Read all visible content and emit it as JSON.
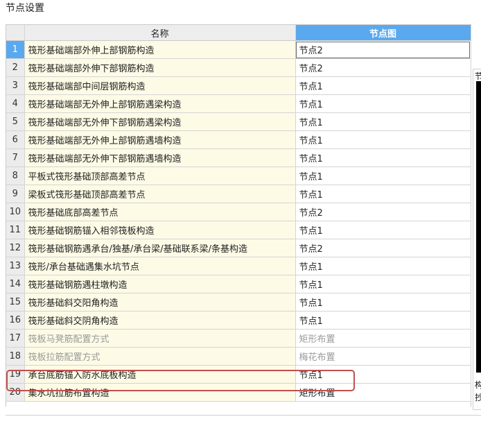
{
  "window": {
    "title": "节点设置"
  },
  "table": {
    "headers": {
      "name": "名称",
      "node": "节点图"
    },
    "rows": [
      {
        "num": "1",
        "name": "筏形基础端部外伸上部钢筋构造",
        "value": "节点2"
      },
      {
        "num": "2",
        "name": "筏形基础端部外伸下部钢筋构造",
        "value": "节点2"
      },
      {
        "num": "3",
        "name": "筏形基础端部中间层钢筋构造",
        "value": "节点1"
      },
      {
        "num": "4",
        "name": "筏形基础端部无外伸上部钢筋遇梁构造",
        "value": "节点1"
      },
      {
        "num": "5",
        "name": "筏形基础端部无外伸下部钢筋遇梁构造",
        "value": "节点1"
      },
      {
        "num": "6",
        "name": "筏形基础端部无外伸上部钢筋遇墙构造",
        "value": "节点1"
      },
      {
        "num": "7",
        "name": "筏形基础端部无外伸下部钢筋遇墙构造",
        "value": "节点1"
      },
      {
        "num": "8",
        "name": "平板式筏形基础顶部高差节点",
        "value": "节点1"
      },
      {
        "num": "9",
        "name": "梁板式筏形基础顶部高差节点",
        "value": "节点1"
      },
      {
        "num": "10",
        "name": "筏形基础底部高差节点",
        "value": "节点2"
      },
      {
        "num": "11",
        "name": "筏形基础钢筋锚入相邻筏板构造",
        "value": "节点1"
      },
      {
        "num": "12",
        "name": "筏形基础钢筋遇承台/独基/承台梁/基础联系梁/条基构造",
        "value": "节点2"
      },
      {
        "num": "13",
        "name": "筏形/承台基础遇集水坑节点",
        "value": "节点1"
      },
      {
        "num": "14",
        "name": "筏形基础钢筋遇柱墩构造",
        "value": "节点1"
      },
      {
        "num": "15",
        "name": "筏形基础斜交阳角构造",
        "value": "节点1"
      },
      {
        "num": "16",
        "name": "筏形基础斜交阴角构造",
        "value": "节点1"
      },
      {
        "num": "17",
        "name": "筏板马凳筋配置方式",
        "value": "矩形布置"
      },
      {
        "num": "18",
        "name": "筏板拉筋配置方式",
        "value": "梅花布置"
      },
      {
        "num": "19",
        "name": "承台底筋锚入防水底板构造",
        "value": "节点1"
      },
      {
        "num": "20",
        "name": "集水坑拉筋布置构造",
        "value": "矩形布置"
      }
    ]
  },
  "side_panel": {
    "top_glyph": "节",
    "bottom_glyph_1": "构",
    "bottom_glyph_2": "抄"
  },
  "colors": {
    "accent": "#5aa9ee",
    "name_cell_bg": "#fdfbe6",
    "highlight_border": "#c0504d",
    "disabled_text": "#9a9a9a"
  }
}
